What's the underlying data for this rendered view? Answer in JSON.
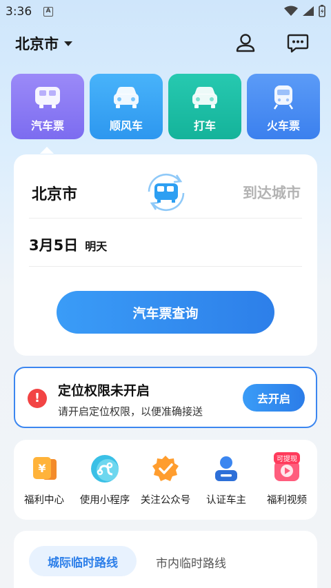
{
  "status_bar": {
    "time": "3:36",
    "notif_letter": "A"
  },
  "header": {
    "city": "北京市",
    "profile_icon": "user-icon",
    "message_icon": "message-icon"
  },
  "tabs": [
    {
      "label": "汽车票",
      "icon": "bus-icon",
      "color": "#8a7cf5",
      "selected": true
    },
    {
      "label": "顺风车",
      "icon": "car-icon",
      "color": "#39a6f5"
    },
    {
      "label": "打车",
      "icon": "taxi-icon",
      "color": "#1fc0a6"
    },
    {
      "label": "火车票",
      "icon": "train-icon",
      "color": "#4a8ef5"
    }
  ],
  "search": {
    "from": "北京市",
    "to_placeholder": "到达城市",
    "date": "3月5日",
    "date_note": "明天",
    "button": "汽车票查询"
  },
  "location_warning": {
    "title": "定位权限未开启",
    "description": "请开启定位权限，以便准确接送",
    "button": "去开启"
  },
  "quick_entries": [
    {
      "label": "福利中心",
      "icon": "wallet-yen-icon"
    },
    {
      "label": "使用小程序",
      "icon": "mini-program-icon"
    },
    {
      "label": "关注公众号",
      "icon": "verified-badge-icon"
    },
    {
      "label": "认证车主",
      "icon": "driver-profile-icon"
    },
    {
      "label": "福利视频",
      "icon": "video-play-icon",
      "badge": "可提现"
    }
  ],
  "routes": {
    "tab_active": "城际临时路线",
    "tab_other": "市内临时路线"
  }
}
